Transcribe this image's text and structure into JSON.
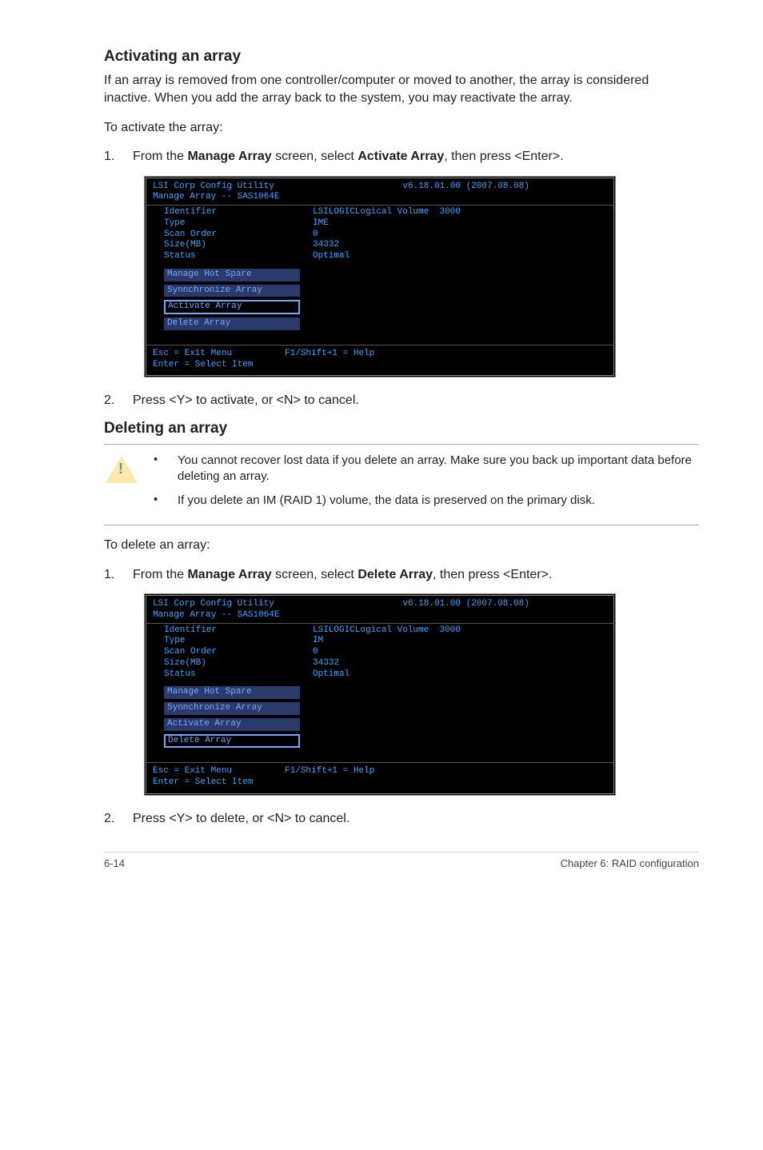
{
  "section1": {
    "title": "Activating an array",
    "intro": "If an array is removed from one controller/computer or moved to another, the array is considered inactive. When you add the array back to the system, you may reactivate the array.",
    "lead": "To activate the array:",
    "step1_num": "1.",
    "step1_a": "From the ",
    "step1_b": "Manage Array",
    "step1_c": " screen, select ",
    "step1_d": "Activate Array",
    "step1_e": ", then press <Enter>.",
    "step2_num": "2.",
    "step2": "Press <Y> to activate, or <N> to cancel."
  },
  "bios1": {
    "util": "LSI Corp Config Utility",
    "ver": "v6.18.01.00 (2007.08.08)",
    "sub": "Manage Array -- SAS1064E",
    "rows": {
      "identifier_k": "Identifier",
      "identifier_v": "LSILOGICLogical Volume  3000",
      "type_k": "Type",
      "type_v": "IME",
      "scan_k": "Scan Order",
      "scan_v": "0",
      "size_k": "Size(MB)",
      "size_v": "34332",
      "status_k": "Status",
      "status_v": "Optimal"
    },
    "menu": {
      "hot": "Manage Hot Spare",
      "sync": "Synnchronize Array",
      "act": "Activate Array",
      "del": "Delete Array"
    },
    "foot": "Esc = Exit Menu          F1/Shift+1 = Help\nEnter = Select Item"
  },
  "section2": {
    "title": "Deleting an array",
    "warn1": "You cannot recover lost data if you delete an array. Make sure you back up important data before deleting an array.",
    "warn2": "If you delete an IM (RAID 1) volume, the data is preserved on the primary disk.",
    "lead": "To delete an array:",
    "step1_num": "1.",
    "step1_a": "From the ",
    "step1_b": "Manage Array",
    "step1_c": " screen, select ",
    "step1_d": "Delete Array",
    "step1_e": ", then press <Enter>.",
    "step2_num": "2.",
    "step2": "Press <Y> to delete, or <N> to cancel."
  },
  "bios2": {
    "util": "LSI Corp Config Utility",
    "ver": "v6.18.01.00 (2007.08.08)",
    "sub": "Manage Array -- SAS1064E",
    "rows": {
      "identifier_k": "Identifier",
      "identifier_v": "LSILOGICLogical Volume  3000",
      "type_k": "Type",
      "type_v": "IM",
      "scan_k": "Scan Order",
      "scan_v": "0",
      "size_k": "Size(MB)",
      "size_v": "34332",
      "status_k": "Status",
      "status_v": "Optimal"
    },
    "menu": {
      "hot": "Manage Hot Spare",
      "sync": "Synnchronize Array",
      "act": "Activate Array",
      "del": "Delete Array"
    },
    "foot": "Esc = Exit Menu          F1/Shift+1 = Help\nEnter = Select Item"
  },
  "footer": {
    "left": "6-14",
    "right": "Chapter 6: RAID configuration"
  },
  "bullet": "•"
}
